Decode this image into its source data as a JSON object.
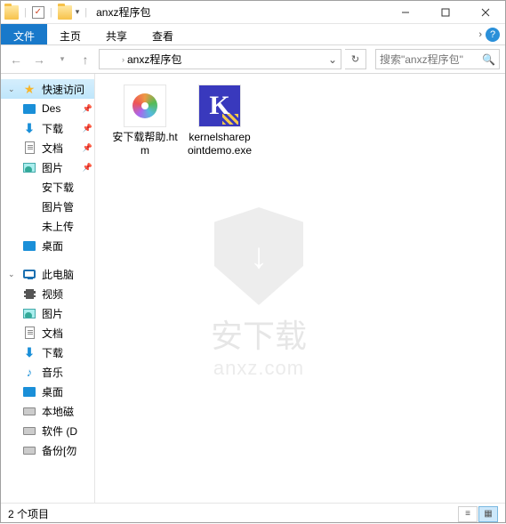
{
  "titlebar": {
    "title": "anxz程序包"
  },
  "ribbon": {
    "tabs": {
      "file": "文件",
      "home": "主页",
      "share": "共享",
      "view": "查看"
    }
  },
  "nav": {
    "breadcrumb": "anxz程序包",
    "search_placeholder": "搜索\"anxz程序包\""
  },
  "sidebar": {
    "quick": "快速访问",
    "items": [
      {
        "label": "Des",
        "icon": "desktop"
      },
      {
        "label": "下载",
        "icon": "down"
      },
      {
        "label": "文档",
        "icon": "doc"
      },
      {
        "label": "图片",
        "icon": "pic"
      },
      {
        "label": "安下载",
        "icon": "folder"
      },
      {
        "label": "图片管",
        "icon": "folder"
      },
      {
        "label": "未上传",
        "icon": "folder"
      },
      {
        "label": "桌面",
        "icon": "desktop"
      }
    ],
    "thispc": "此电脑",
    "pcitems": [
      {
        "label": "视频",
        "icon": "vid"
      },
      {
        "label": "图片",
        "icon": "pic"
      },
      {
        "label": "文档",
        "icon": "doc"
      },
      {
        "label": "下载",
        "icon": "down"
      },
      {
        "label": "音乐",
        "icon": "music"
      },
      {
        "label": "桌面",
        "icon": "desktop"
      },
      {
        "label": "本地磁",
        "icon": "drive"
      },
      {
        "label": "软件 (D",
        "icon": "drive"
      },
      {
        "label": "备份[勿",
        "icon": "drive"
      }
    ]
  },
  "files": {
    "items": [
      {
        "name": "安下载帮助.htm",
        "type": "htm"
      },
      {
        "name": "kernelsharepointdemo.exe",
        "type": "exe"
      }
    ]
  },
  "watermark": {
    "line1": "安下载",
    "line2": "anxz.com"
  },
  "statusbar": {
    "count": "2 个项目"
  }
}
